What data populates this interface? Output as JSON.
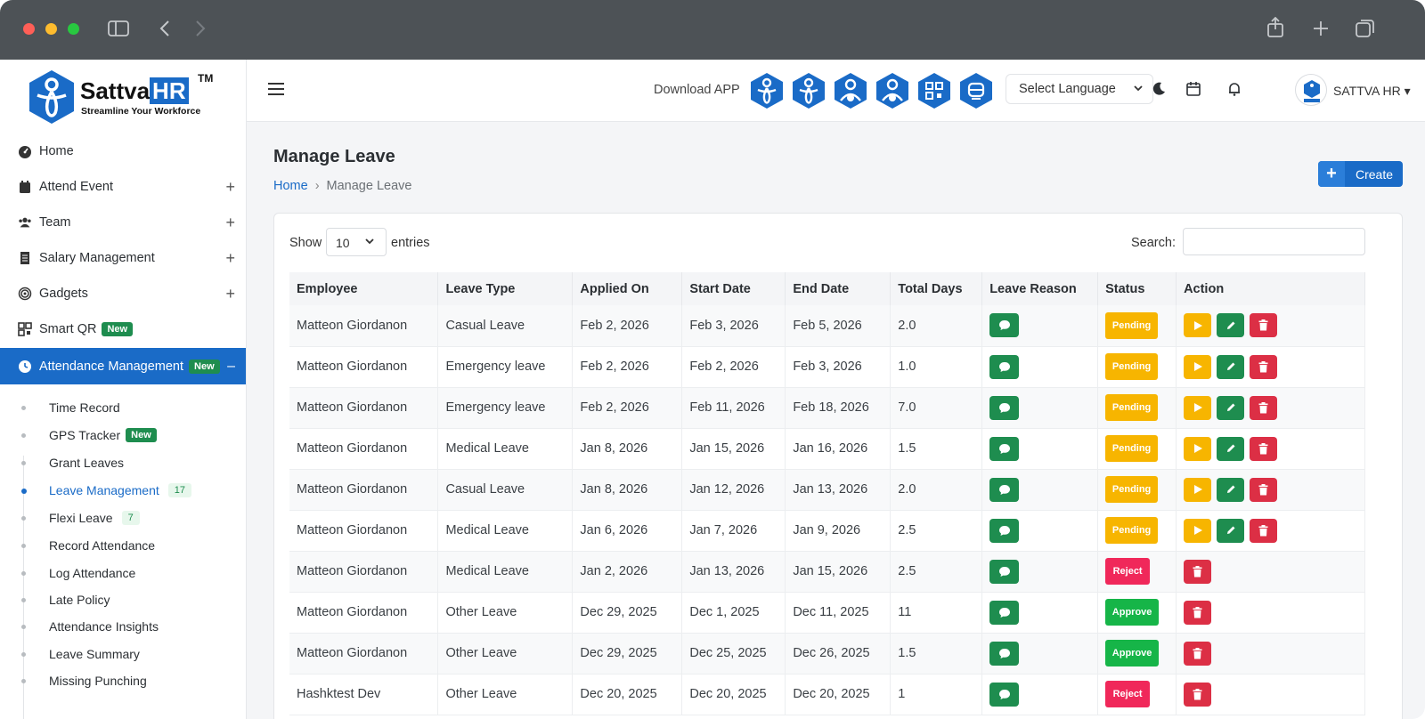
{
  "brand": {
    "name_a": "Sattva",
    "name_b": "HR",
    "tm": "TM",
    "tagline": "Streamline Your Workforce",
    "colors": {
      "primary": "#1a6bc7",
      "success": "#1e8d4f",
      "warning": "#f7b500",
      "danger": "#dc2f45"
    }
  },
  "sidebar": {
    "items": [
      {
        "label": "Home",
        "icon": "dashboard-icon",
        "expandable": false
      },
      {
        "label": "Attend Event",
        "icon": "calendar-icon",
        "expandable": true
      },
      {
        "label": "Team",
        "icon": "users-icon",
        "expandable": true
      },
      {
        "label": "Salary Management",
        "icon": "receipt-icon",
        "expandable": true
      },
      {
        "label": "Gadgets",
        "icon": "fingerprint-icon",
        "expandable": true
      },
      {
        "label": "Smart QR",
        "icon": "qr-icon",
        "badge": "New"
      },
      {
        "label": "Attendance Management",
        "icon": "clock-icon",
        "badge": "New",
        "collapse": "–"
      }
    ],
    "sub_items": [
      {
        "label": "Time Record"
      },
      {
        "label": "GPS Tracker",
        "badge": "New"
      },
      {
        "label": "Grant Leaves"
      },
      {
        "label": "Leave Management",
        "count": "17"
      },
      {
        "label": "Flexi Leave",
        "count": "7"
      },
      {
        "label": "Record Attendance"
      },
      {
        "label": "Log Attendance"
      },
      {
        "label": "Late Policy"
      },
      {
        "label": "Attendance Insights"
      },
      {
        "label": "Leave Summary"
      },
      {
        "label": "Missing Punching"
      }
    ]
  },
  "topbar": {
    "download_label": "Download APP",
    "language_placeholder": "Select Language",
    "user_name": "SATTVA HR",
    "user_caret": "▾"
  },
  "page": {
    "title": "Manage Leave",
    "breadcrumb": {
      "home": "Home",
      "sep": "›",
      "current": "Manage Leave"
    },
    "create_label": "Create",
    "create_plus": "+"
  },
  "table_controls": {
    "show_label": "Show",
    "entries_value": "10",
    "entries_label": "entries",
    "search_label": "Search:"
  },
  "table": {
    "headers": [
      "Employee",
      "Leave Type",
      "Applied On",
      "Start Date",
      "End Date",
      "Total Days",
      "Leave Reason",
      "Status",
      "Action"
    ],
    "rows": [
      {
        "employee": "Matteon Giordanon",
        "type": "Casual Leave",
        "applied": "Feb 2, 2026",
        "start": "Feb 3, 2026",
        "end": "Feb 5, 2026",
        "days": "2.0",
        "status": "Pending"
      },
      {
        "employee": "Matteon Giordanon",
        "type": "Emergency leave",
        "applied": "Feb 2, 2026",
        "start": "Feb 2, 2026",
        "end": "Feb 3, 2026",
        "days": "1.0",
        "status": "Pending"
      },
      {
        "employee": "Matteon Giordanon",
        "type": "Emergency leave",
        "applied": "Feb 2, 2026",
        "start": "Feb 11, 2026",
        "end": "Feb 18, 2026",
        "days": "7.0",
        "status": "Pending"
      },
      {
        "employee": "Matteon Giordanon",
        "type": "Medical Leave",
        "applied": "Jan 8, 2026",
        "start": "Jan 15, 2026",
        "end": "Jan 16, 2026",
        "days": "1.5",
        "status": "Pending"
      },
      {
        "employee": "Matteon Giordanon",
        "type": "Casual Leave",
        "applied": "Jan 8, 2026",
        "start": "Jan 12, 2026",
        "end": "Jan 13, 2026",
        "days": "2.0",
        "status": "Pending"
      },
      {
        "employee": "Matteon Giordanon",
        "type": "Medical Leave",
        "applied": "Jan 6, 2026",
        "start": "Jan 7, 2026",
        "end": "Jan 9, 2026",
        "days": "2.5",
        "status": "Pending"
      },
      {
        "employee": "Matteon Giordanon",
        "type": "Medical Leave",
        "applied": "Jan 2, 2026",
        "start": "Jan 13, 2026",
        "end": "Jan 15, 2026",
        "days": "2.5",
        "status": "Reject"
      },
      {
        "employee": "Matteon Giordanon",
        "type": "Other Leave",
        "applied": "Dec 29, 2025",
        "start": "Dec 1, 2025",
        "end": "Dec 11, 2025",
        "days": "11",
        "status": "Approve"
      },
      {
        "employee": "Matteon Giordanon",
        "type": "Other Leave",
        "applied": "Dec 29, 2025",
        "start": "Dec 25, 2025",
        "end": "Dec 26, 2025",
        "days": "1.5",
        "status": "Approve"
      },
      {
        "employee": "Hashktest Dev",
        "type": "Other Leave",
        "applied": "Dec 20, 2025",
        "start": "Dec 20, 2025",
        "end": "Dec 20, 2025",
        "days": "1",
        "status": "Reject"
      }
    ]
  }
}
